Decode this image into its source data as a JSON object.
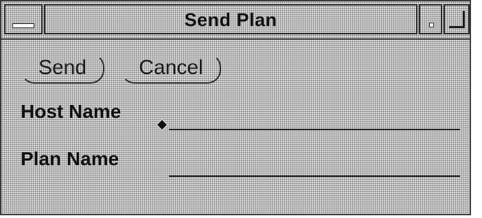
{
  "window": {
    "title": "Send Plan"
  },
  "toolbar": {
    "send_label": "Send",
    "cancel_label": "Cancel"
  },
  "form": {
    "host_name_label": "Host Name",
    "host_name_value": "",
    "plan_name_label": "Plan Name",
    "plan_name_value": ""
  }
}
